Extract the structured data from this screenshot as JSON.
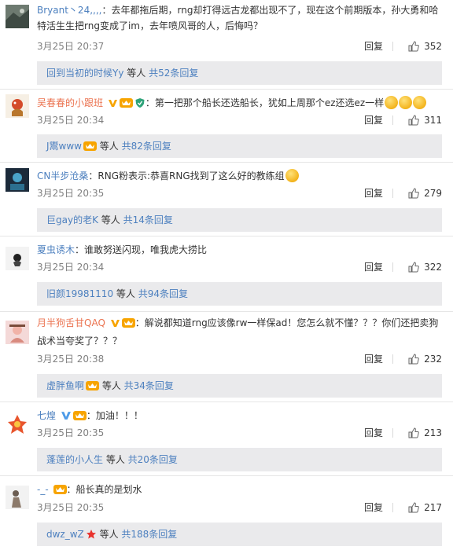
{
  "comments": [
    {
      "user": "Bryant丶24,,,,",
      "colon": "：",
      "text": "去年都拖后期，rng却打得远古龙都出现不了，现在这个前期版本，孙大勇和哈特活生生把rng变成了im，去年喷风哥的人，后悔吗？",
      "time": "3月25日 20:37",
      "reply": "回复",
      "likes": "352",
      "sub_user": "回到当初的时候Yy",
      "sub_mid": " 等人 ",
      "sub_total": "共52条回复"
    },
    {
      "user": "吴春春的小跟班",
      "colon": "：",
      "text": "第一把那个船长还选船长，犹如上周那个ez还选ez一样",
      "time": "3月25日 20:34",
      "reply": "回复",
      "likes": "311",
      "sub_user": "J鬻www",
      "sub_mid": " 等人 ",
      "sub_total": "共82条回复"
    },
    {
      "user": "CN半步沧桑",
      "colon": "：",
      "text": "RNG粉表示:恭喜RNG找到了这么好的教练组",
      "time": "3月25日 20:35",
      "reply": "回复",
      "likes": "279",
      "sub_user": "巨gay的老K",
      "sub_mid": " 等人 ",
      "sub_total": "共14条回复"
    },
    {
      "user": "夏虫诱木",
      "colon": "：",
      "text": "谁敢努送闪现，唯我虎大捞比",
      "time": "3月25日 20:34",
      "reply": "回复",
      "likes": "322",
      "sub_user": "旧颜19981110",
      "sub_mid": " 等人 ",
      "sub_total": "共94条回复"
    },
    {
      "user": "月半狗舌甘QAQ",
      "colon": "：",
      "text": "解说都知道rng应该像rw一样保ad！您怎么就不懂？？？你们还把卖狗战术当夸奖了？？？",
      "time": "3月25日 20:38",
      "reply": "回复",
      "likes": "232",
      "sub_user": "虚胖鱼啊",
      "sub_mid": " 等人 ",
      "sub_total": "共34条回复"
    },
    {
      "user": "七煌",
      "colon": "：",
      "text": "加油！！！",
      "time": "3月25日 20:35",
      "reply": "回复",
      "likes": "213",
      "sub_user": "蓬莲的小人生",
      "sub_mid": " 等人 ",
      "sub_total": "共20条回复"
    },
    {
      "user": "-_-",
      "colon": "：",
      "text": "船长真的是划水",
      "time": "3月25日 20:35",
      "reply": "回复",
      "likes": "217",
      "sub_user": "dwz_wZ",
      "sub_mid": " 等人 ",
      "sub_total": "共188条回复"
    }
  ],
  "colors": {
    "username_orange": "#eb7350",
    "link_blue": "#4d80bf",
    "sub_bg": "#eaeaec",
    "vip_orange": "#f7a400",
    "verified_blue": "#4d9be8"
  },
  "icons": {
    "like": "thumbs-up-icon",
    "vip": "vip-crown-badge",
    "verified": "verified-v-badge",
    "emoji": "grin-emoji"
  }
}
